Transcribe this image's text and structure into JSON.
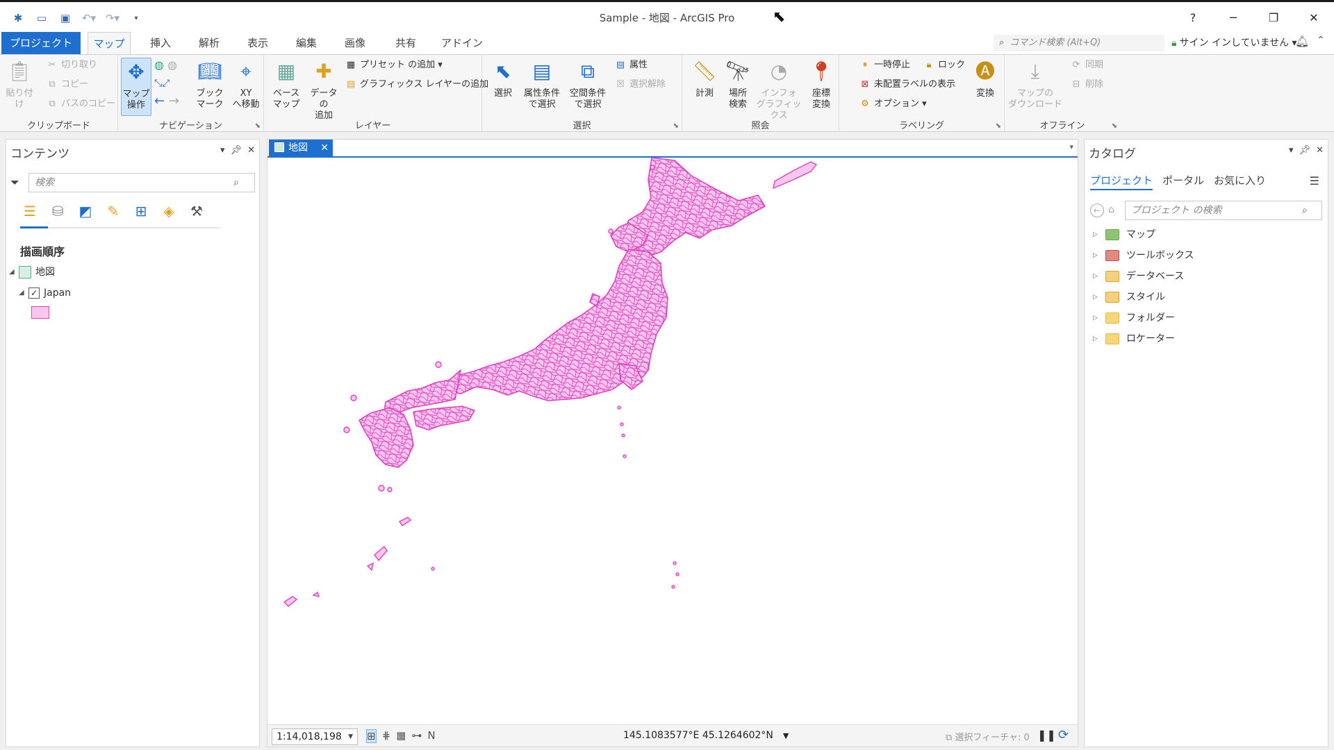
{
  "window": {
    "title": "Sample - 地図 - ArcGIS Pro",
    "help": "?",
    "minimize": "─",
    "restore": "❐",
    "close": "✕"
  },
  "qat": [
    "new-project-icon",
    "open-project-icon",
    "save-project-icon",
    "undo-icon",
    "redo-icon",
    "customize-icon"
  ],
  "tabs": {
    "project": "プロジェクト",
    "items": [
      "マップ",
      "挿入",
      "解析",
      "表示",
      "編集",
      "画像",
      "共有",
      "アドイン"
    ],
    "active": "マップ"
  },
  "command_search": {
    "placeholder": "コマンド検索 (Alt+Q)"
  },
  "signin": "サイン インしていません",
  "ribbon": {
    "clipboard": {
      "label": "クリップボード",
      "paste": "貼り付け",
      "cut": "切り取り",
      "copy": "コピー",
      "copy_path": "パスのコピー"
    },
    "navigation": {
      "label": "ナビゲーション",
      "explore": "マップ\n操作",
      "bookmarks": "ブック\nマーク",
      "goto_xy": "XY\nへ移動"
    },
    "layer": {
      "label": "レイヤー",
      "basemap": "ベース\nマップ",
      "add_data": "データの\n追加",
      "add_preset": "プリセット の追加",
      "add_graphics": "グラフィックス レイヤーの追加"
    },
    "selection": {
      "label": "選択",
      "select": "選択",
      "by_attributes": "属性条件\nで選択",
      "by_location": "空間条件\nで選択",
      "attributes": "属性",
      "clear": "選択解除"
    },
    "inquiry": {
      "label": "照会",
      "measure": "計測",
      "locate": "場所\n検索",
      "infographics": "インフォ\nグラフィックス",
      "coordinate_conversion": "座標\n変換"
    },
    "labeling": {
      "label": "ラベリング",
      "pause": "一時停止",
      "lock": "ロック",
      "unplaced": "未配置ラベルの表示",
      "options": "オプション",
      "convert": "変換"
    },
    "offline": {
      "label": "オフライン",
      "download_map": "マップの\nダウンロード",
      "sync": "同期",
      "remove": "削除"
    }
  },
  "contents": {
    "title": "コンテンツ",
    "search_placeholder": "検索",
    "drawing_order": "描画順序",
    "map_name": "地図",
    "layer_name": "Japan",
    "layer_checked": true,
    "symbol_fill": "#f7c7ee",
    "symbol_outline": "#e040c0"
  },
  "map_view": {
    "tab_label": "地図",
    "scale": "1:14,018,198",
    "coordinates": "145.1083577°E 45.1264602°N",
    "selected_features": "選択フィーチャ: 0"
  },
  "catalog": {
    "title": "カタログ",
    "tabs": [
      "プロジェクト",
      "ポータル",
      "お気に入り"
    ],
    "active_tab": "プロジェクト",
    "search_placeholder": "プロジェクト の検索",
    "items": [
      {
        "label": "マップ",
        "color": "#6aa84f"
      },
      {
        "label": "ツールボックス",
        "color": "#c0504d"
      },
      {
        "label": "データベース",
        "color": "#e0a020"
      },
      {
        "label": "スタイル",
        "color": "#e0a020"
      },
      {
        "label": "フォルダー",
        "color": "#e8b840"
      },
      {
        "label": "ロケーター",
        "color": "#e8b840"
      }
    ]
  },
  "colors": {
    "accent": "#1f6fd1",
    "feature_outline": "#e040c0",
    "feature_fill": "#f7c7ee"
  }
}
